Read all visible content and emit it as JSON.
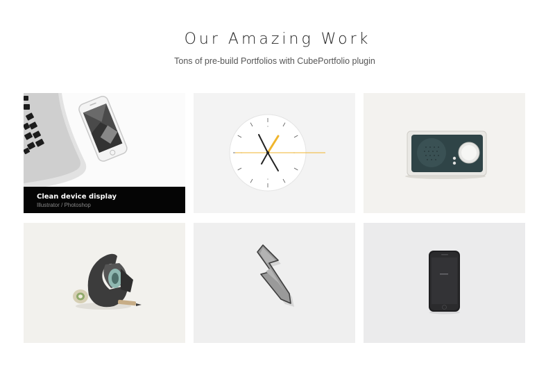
{
  "section": {
    "title": "Our Amazing Work",
    "subtitle": "Tons of pre-build Portfolios with CubePortfolio plugin"
  },
  "portfolio": {
    "items": [
      {
        "image": "laptop-and-phone-image",
        "title": "Clean device display",
        "categories": "Illustrator / Photoshop"
      },
      {
        "image": "wall-clock-image"
      },
      {
        "image": "radio-speaker-image"
      },
      {
        "image": "concrete-tape-dispenser-image"
      },
      {
        "image": "lightning-bolt-image"
      },
      {
        "image": "smartphone-image"
      }
    ]
  }
}
